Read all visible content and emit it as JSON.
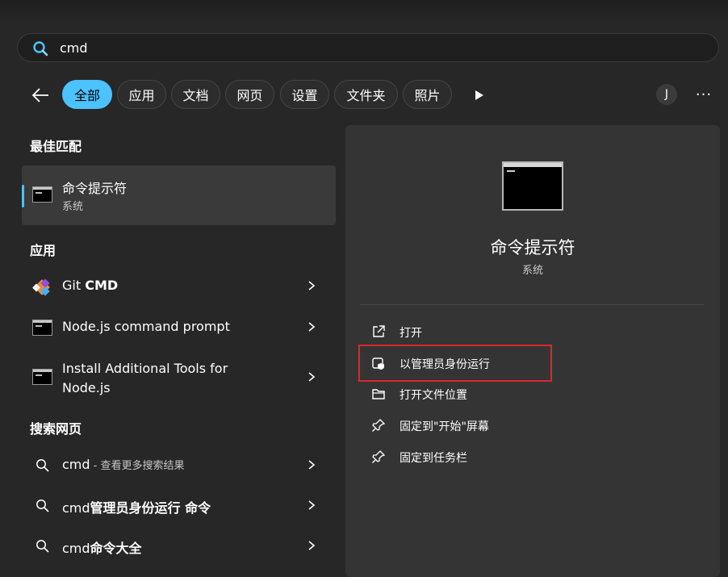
{
  "search": {
    "query": "cmd"
  },
  "filters": [
    {
      "label": "全部",
      "active": true
    },
    {
      "label": "应用"
    },
    {
      "label": "文档"
    },
    {
      "label": "网页"
    },
    {
      "label": "设置"
    },
    {
      "label": "文件夹"
    },
    {
      "label": "照片"
    }
  ],
  "account": {
    "initial": "J",
    "more_label": "···"
  },
  "best_match": {
    "heading": "最佳匹配",
    "title": "命令提示符",
    "subtitle": "系统"
  },
  "apps": {
    "heading": "应用",
    "items": [
      {
        "prefix": "Git ",
        "bold": "CMD"
      },
      {
        "label": "Node.js command prompt"
      },
      {
        "line1": "Install Additional Tools for",
        "line2": "Node.js"
      }
    ]
  },
  "web": {
    "heading": "搜索网页",
    "items": [
      {
        "query": "cmd",
        "suffix": " - 查看更多搜索结果"
      },
      {
        "prefix": "cmd",
        "bold": "管理员身份运行 命令"
      },
      {
        "prefix": "cmd",
        "bold": "命令大全"
      }
    ]
  },
  "detail": {
    "title": "命令提示符",
    "subtitle": "系统",
    "actions": [
      {
        "label": "打开",
        "icon": "open-external-icon"
      },
      {
        "label": "以管理员身份运行",
        "icon": "shield-admin-icon"
      },
      {
        "label": "打开文件位置",
        "icon": "folder-icon"
      },
      {
        "label": "固定到\"开始\"屏幕",
        "icon": "pin-icon"
      },
      {
        "label": "固定到任务栏",
        "icon": "pin-icon"
      }
    ]
  },
  "colors": {
    "accent": "#4cc2ff",
    "highlight": "#e0262b",
    "background": "#272727",
    "panel": "#343434"
  }
}
